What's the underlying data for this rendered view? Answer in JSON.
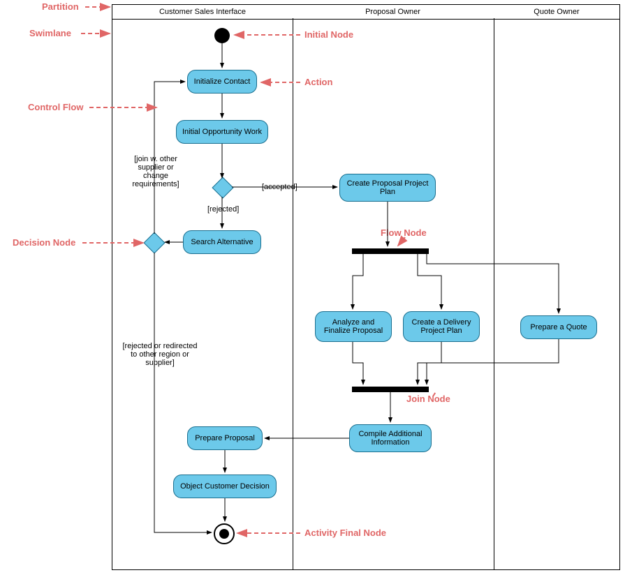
{
  "swimlanes": {
    "lane1": "Customer Sales Interface",
    "lane2": "Proposal Owner",
    "lane3": "Quote Owner"
  },
  "actions": {
    "initialize_contact": "Initialize Contact",
    "initial_opportunity": "Initial Opportunity Work",
    "search_alternative": "Search Alternative",
    "create_proposal_plan": "Create Proposal Project Plan",
    "analyze_finalize": "Analyze and Finalize Proposal",
    "create_delivery": "Create a Delivery Project Plan",
    "prepare_quote": "Prepare a Quote",
    "compile_info": "Compile Additional Information",
    "prepare_proposal": "Prepare Proposal",
    "object_decision": "Object Customer Decision"
  },
  "guards": {
    "accepted": "[accepted]",
    "rejected": "[rejected]",
    "join_other": "[join w. other supplier or change requirements]",
    "rejected_redirect": "[rejected or redirected to other region or supplier]"
  },
  "callouts": {
    "partition": "Partition",
    "swimlane": "Swimlane",
    "control_flow": "Control Flow",
    "decision_node": "Decision Node",
    "initial_node": "Initial Node",
    "action": "Action",
    "flow_node": "Flow Node",
    "join_node": "Join Node",
    "final_node": "Activity Final Node"
  }
}
